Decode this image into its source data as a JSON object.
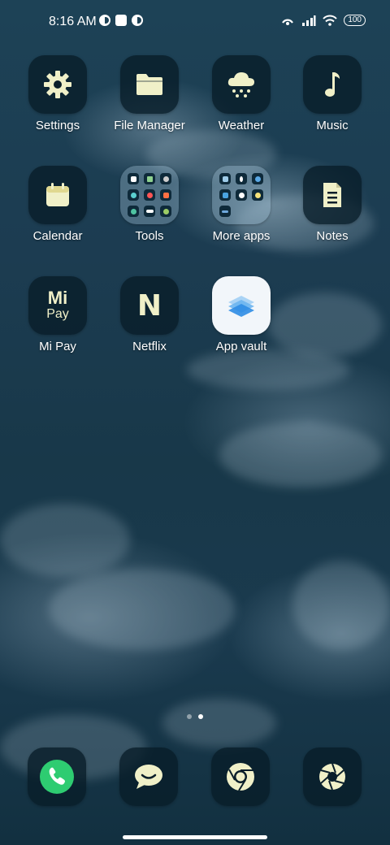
{
  "status_bar": {
    "time": "8:16 AM",
    "battery": "100",
    "icons_left": [
      "app-notification-icon",
      "square-notification-icon",
      "app-notification-icon"
    ],
    "icons_right": [
      "hotspot-icon",
      "signal-icon",
      "wifi-icon",
      "battery-icon"
    ]
  },
  "apps": [
    {
      "label": "Settings",
      "icon": "gear-icon"
    },
    {
      "label": "File Manager",
      "icon": "folder-icon"
    },
    {
      "label": "Weather",
      "icon": "cloud-snow-icon"
    },
    {
      "label": "Music",
      "icon": "music-note-icon"
    },
    {
      "label": "Calendar",
      "icon": "calendar-icon"
    },
    {
      "label": "Tools",
      "icon": "folder-grid-icon"
    },
    {
      "label": "More apps",
      "icon": "folder-grid-icon"
    },
    {
      "label": "Notes",
      "icon": "note-icon"
    },
    {
      "label": "Mi Pay",
      "icon": "mi-pay-icon",
      "icon_text_top": "Mi",
      "icon_text_bottom": "Pay"
    },
    {
      "label": "Netflix",
      "icon": "netflix-icon",
      "icon_text": "N"
    },
    {
      "label": "App vault",
      "icon": "app-vault-icon"
    }
  ],
  "dock": [
    {
      "icon": "phone-icon"
    },
    {
      "icon": "messages-icon"
    },
    {
      "icon": "chrome-icon"
    },
    {
      "icon": "camera-icon"
    }
  ],
  "pages": {
    "count": 2,
    "active": 2
  },
  "colors": {
    "icon_tile": "#0a1e2a",
    "icon_glyph": "#f0f0c8",
    "phone_green": "#2ecc71",
    "wallpaper_base": "#1c3c51"
  }
}
